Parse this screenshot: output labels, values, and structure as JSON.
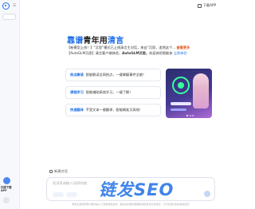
{
  "top": {
    "download_label": "下载APP"
  },
  "sidebar": {
    "app_download_title": "扫描下载",
    "app_download_sub": "APP"
  },
  "hero": {
    "title_hl1": "靠谱",
    "title_mid": "青年用",
    "title_hl2": "清言"
  },
  "notice": {
    "line1_prefix": "【新模型上线！】“沉思”模式已上线清言主对话，来自“沉思，追然这个... ",
    "line1_emph": "查看更多",
    "line2_prefix": "【AutoGLM沉思】清言客户端体验，",
    "line2_bold": "AutoGLM沉思，",
    "line2_link": "欢迎体验智能体 ",
    "line2_end": "立即体验"
  },
  "cards": [
    {
      "tag": "热点解读",
      "desc": "智能解读全网热点，一键掌握事件全貌！"
    },
    {
      "tag": "课程学习",
      "desc": "智能辅助高效学习，一键了解！"
    },
    {
      "tag": "快速翻译",
      "desc": "不受文本一键翻译，智能精准又高效！"
    }
  ],
  "input": {
    "new_chat": "新建对话",
    "placeholder": "发消息或输入/选择技能",
    "footer": "服务生成的所有内容均由人工智能模型生成，其生成内容的准确性和完整性无法保证，不代表我们的态度或观点"
  },
  "watermark": "链发SEO",
  "colors": {
    "accent": "#1f6fe5",
    "notice_emph": "#e0591f"
  },
  "icons": {
    "logo": "logo-icon",
    "download": "download-icon",
    "new_chat": "new-chat-icon",
    "send": "send-icon"
  }
}
